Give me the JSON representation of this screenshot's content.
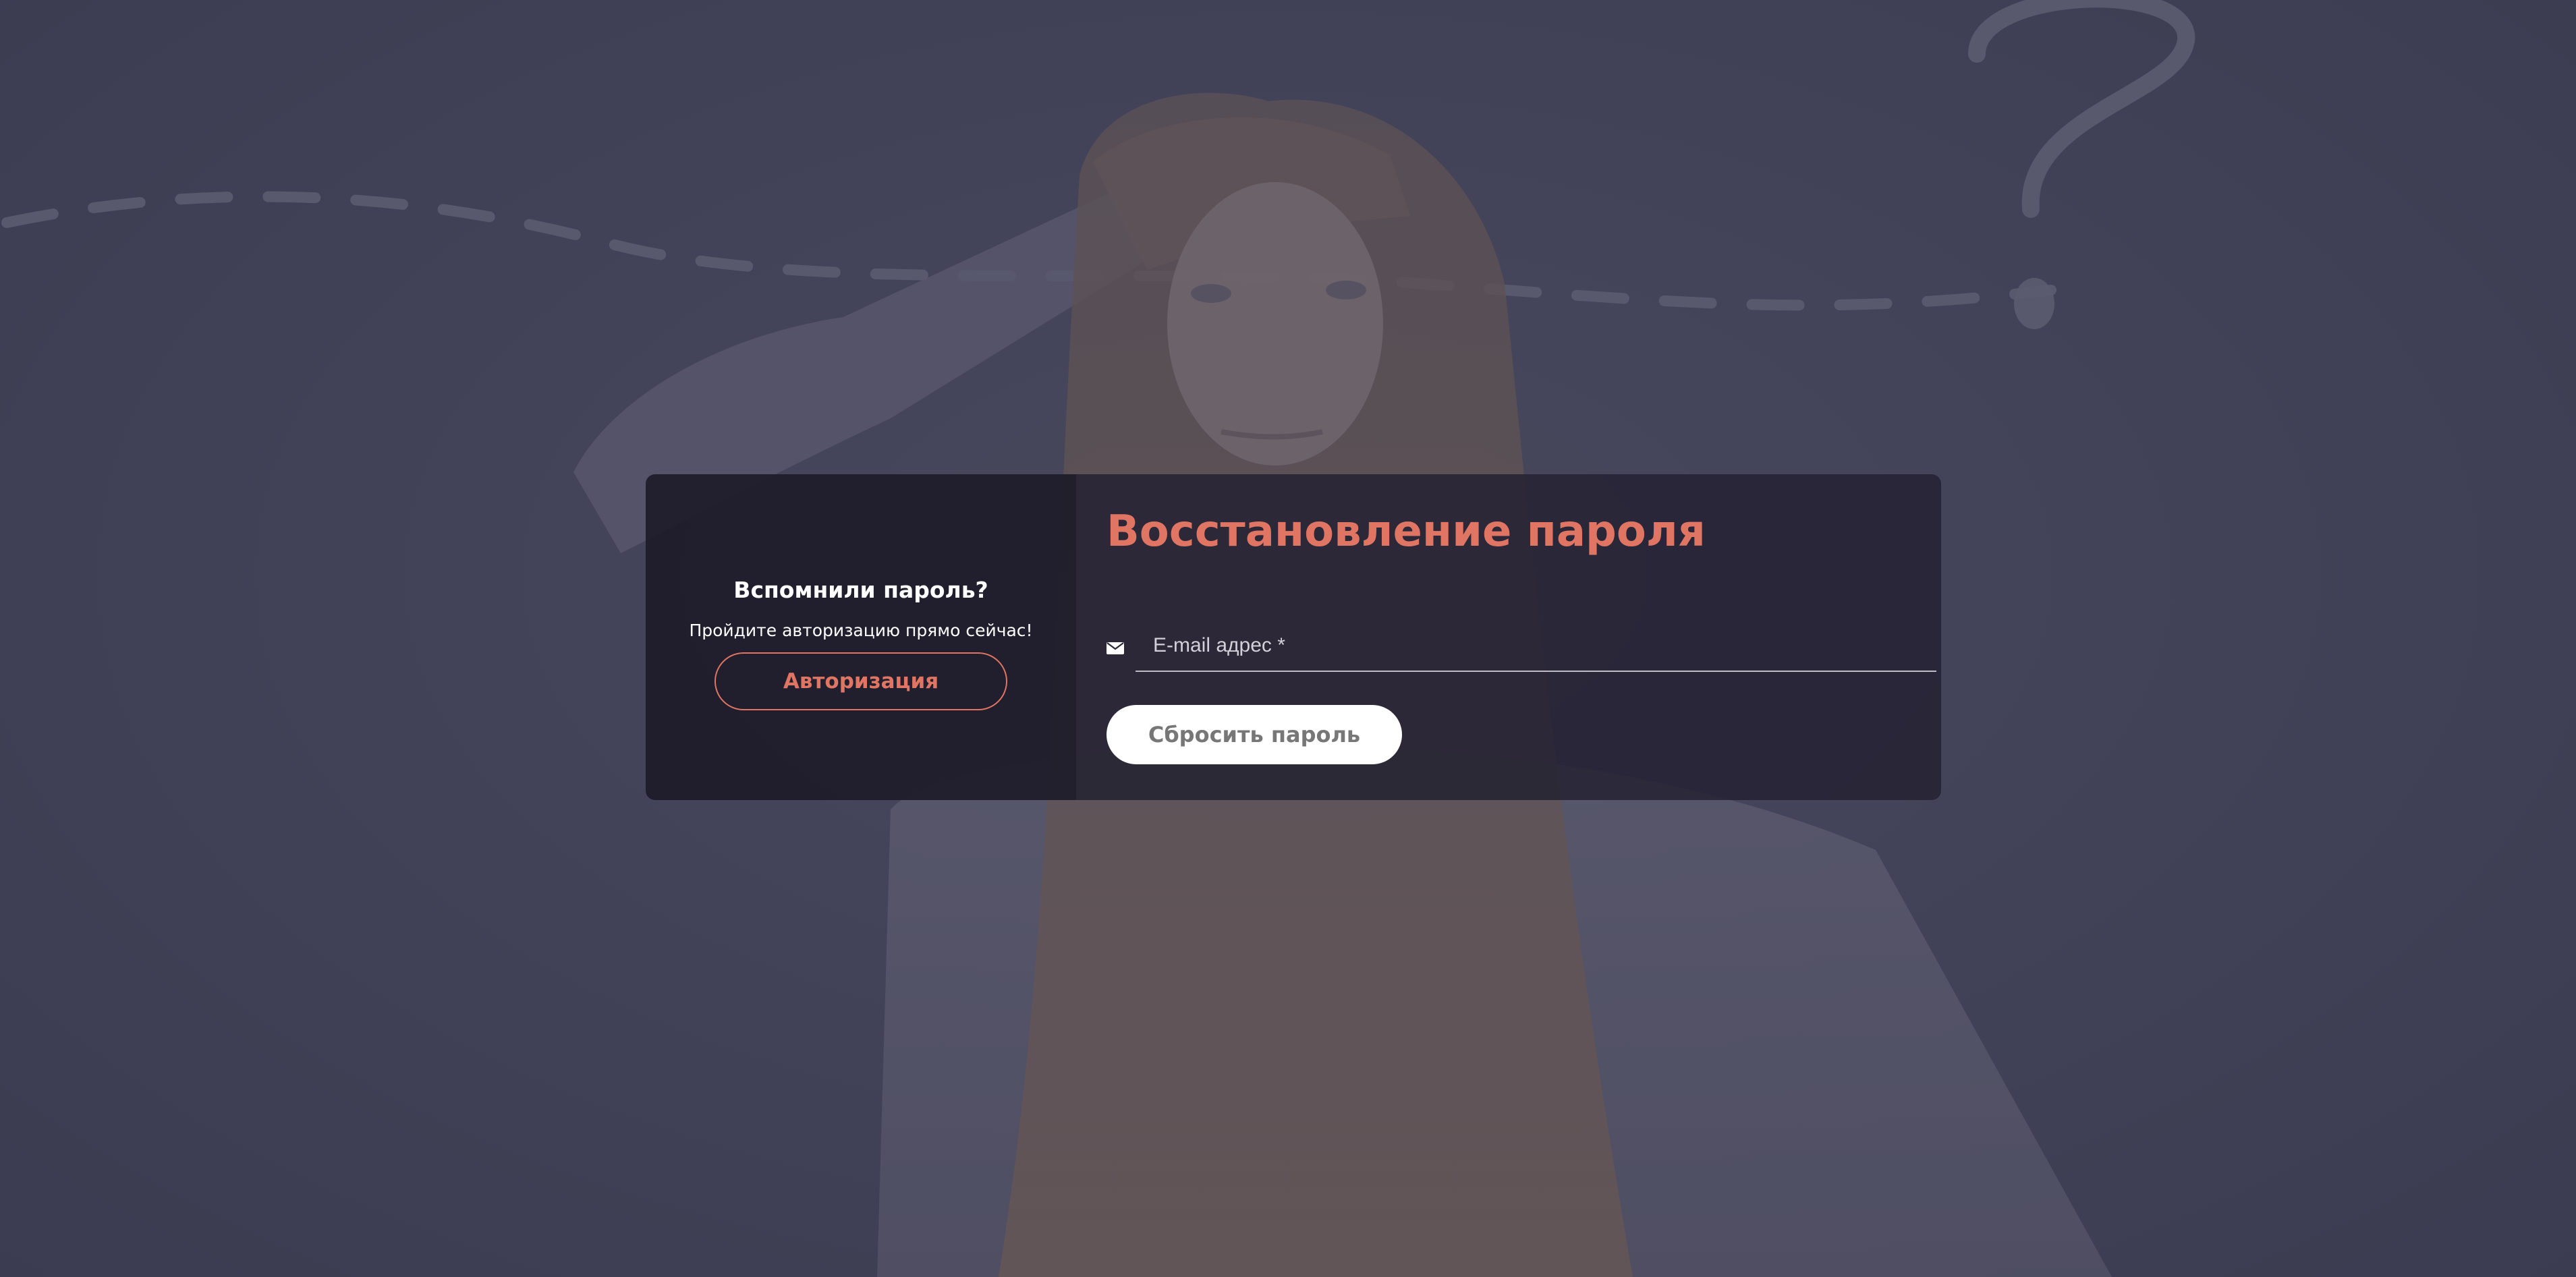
{
  "recall": {
    "title": "Вспомнили пароль?",
    "subtitle": "Пройдите авторизацию прямо сейчас!",
    "login_label": "Авторизация"
  },
  "reset": {
    "title": "Восстановление пароля",
    "email_placeholder": "E-mail адрес *",
    "email_value": "",
    "submit_label": "Сбросить пароль"
  },
  "icons": {
    "email": "envelope-icon"
  },
  "colors": {
    "accent": "#e07563",
    "overlay_dark": "#1e1c2a",
    "overlay_panel": "#242232",
    "button_bg": "#ffffff",
    "button_text": "#777777"
  }
}
